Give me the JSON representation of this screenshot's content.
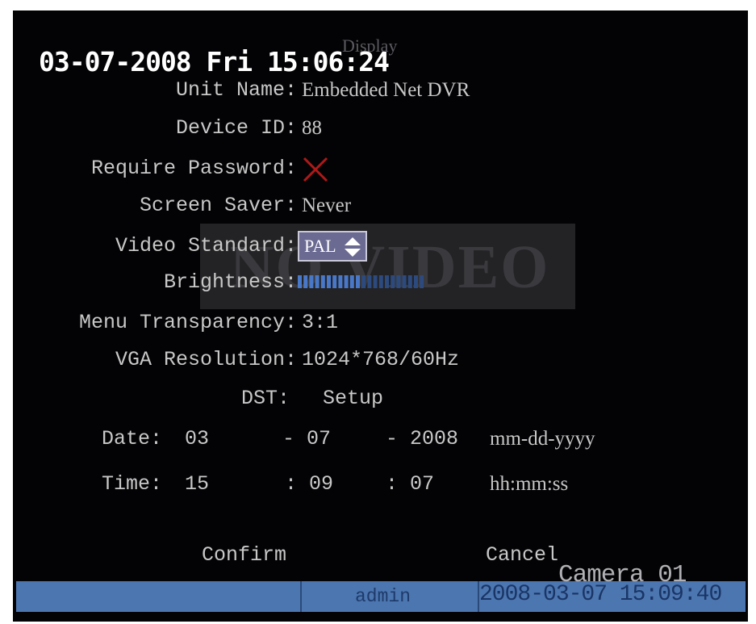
{
  "header": {
    "title": "Display",
    "clock": "03-07-2008 Fri 15:06:24"
  },
  "fields": {
    "unit_name": {
      "label": "Unit Name:",
      "value": "Embedded Net DVR"
    },
    "device_id": {
      "label": "Device ID:",
      "value": "88"
    },
    "require_password": {
      "label": "Require Password:",
      "checked": false
    },
    "screen_saver": {
      "label": "Screen Saver:",
      "value": "Never"
    },
    "video_standard": {
      "label": "Video Standard:",
      "value": "PAL"
    },
    "brightness": {
      "label": "Brightness:",
      "level": 0.5
    },
    "menu_transparency": {
      "label": "Menu Transparency:",
      "value": "3:1"
    },
    "vga_resolution": {
      "label": "VGA Resolution:",
      "value": "1024*768/60Hz"
    },
    "dst": {
      "label": "DST:",
      "button": "Setup"
    }
  },
  "date": {
    "label": "Date:",
    "month": "03",
    "day": "- 07",
    "year": "- 2008",
    "format": "mm-dd-yyyy"
  },
  "time": {
    "label": "Time:",
    "hour": "15",
    "minute": ": 09",
    "second": ": 07",
    "format": "hh:mm:ss"
  },
  "overlay": {
    "no_video": "NO VIDEO",
    "camera": "Camera 01"
  },
  "buttons": {
    "confirm": "Confirm",
    "cancel": "Cancel"
  },
  "status_bar": {
    "user": "admin",
    "datetime": "2008-03-07 15:09:40"
  },
  "colors": {
    "background": "#030305",
    "status_bar": "#4c76b0",
    "unchecked_mark": "#b01818",
    "select_bg": "#6a6a92"
  }
}
